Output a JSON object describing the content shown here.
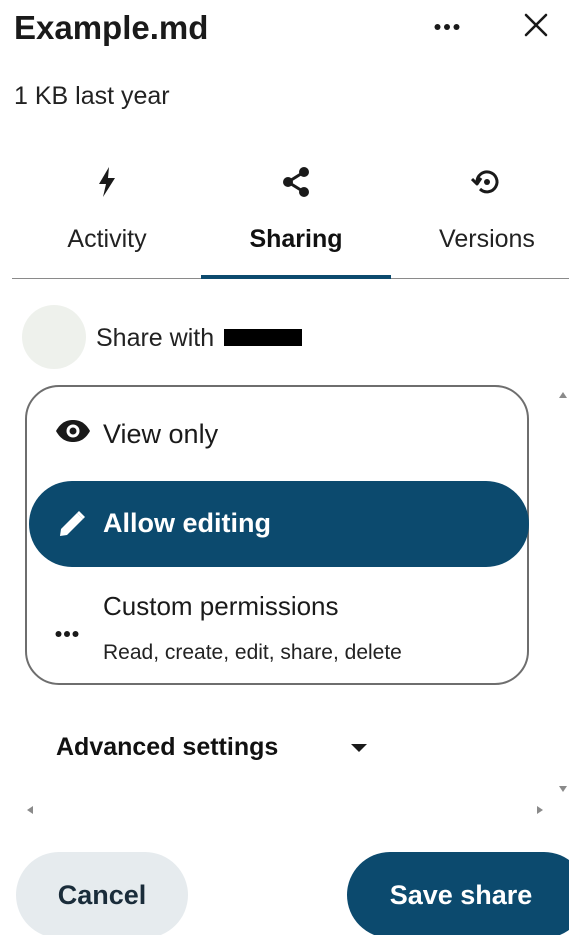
{
  "header": {
    "title": "Example.md",
    "subtitle": "1 KB last year",
    "more_icon": "more-horizontal-icon",
    "close_icon": "close-icon"
  },
  "tabs": [
    {
      "label": "Activity",
      "icon": "lightning-icon",
      "active": false
    },
    {
      "label": "Sharing",
      "icon": "share-icon",
      "active": true
    },
    {
      "label": "Versions",
      "icon": "history-icon",
      "active": false
    }
  ],
  "share": {
    "label": "Share with",
    "avatar": "avatar"
  },
  "permissions": {
    "options": [
      {
        "label": "View only",
        "icon": "eye-icon",
        "selected": false
      },
      {
        "label": "Allow editing",
        "icon": "pencil-icon",
        "selected": true
      },
      {
        "label": "Custom permissions",
        "description": "Read, create, edit, share, delete",
        "icon": "more-horizontal-icon",
        "selected": false
      }
    ]
  },
  "advanced": {
    "label": "Advanced settings",
    "icon": "caret-down-icon"
  },
  "footer": {
    "cancel_label": "Cancel",
    "save_label": "Save share"
  },
  "colors": {
    "accent": "#0c4a6e",
    "cancel_bg": "#e6ebee",
    "avatar_bg": "#eef1ec"
  }
}
